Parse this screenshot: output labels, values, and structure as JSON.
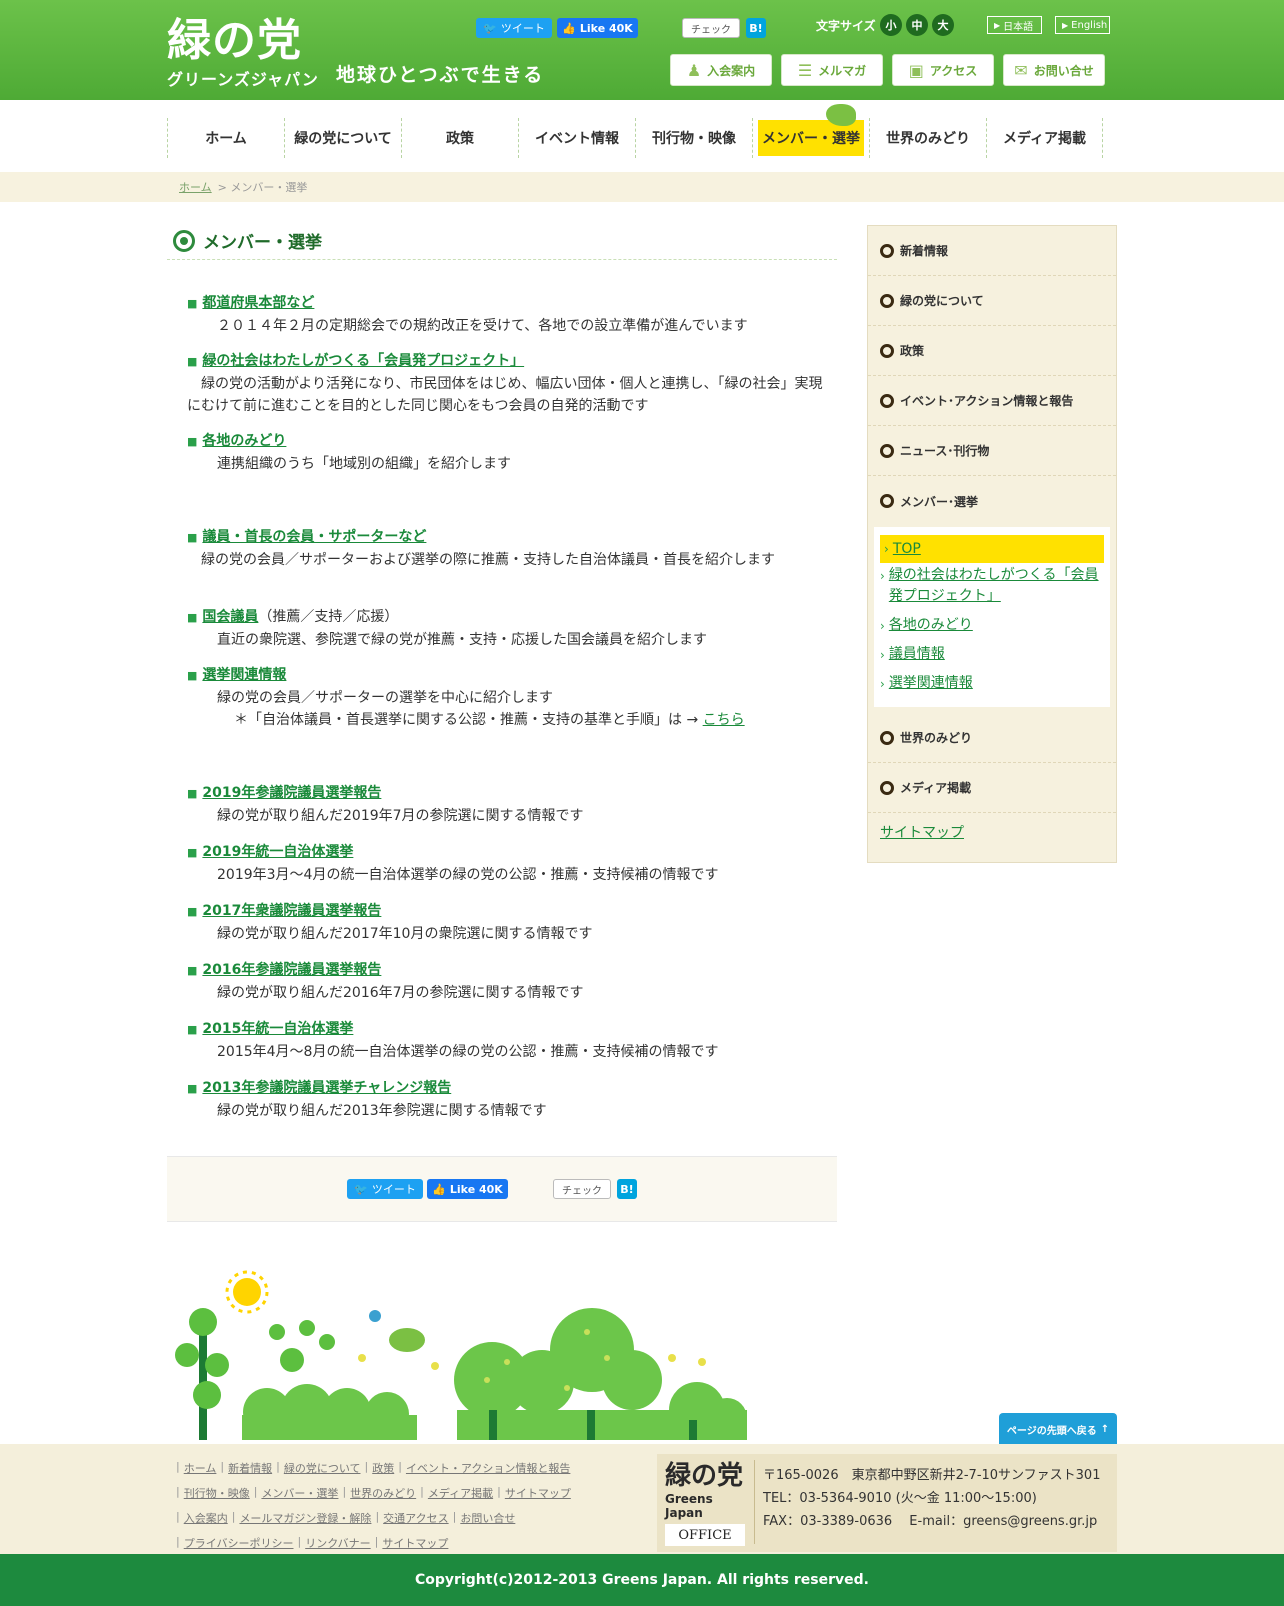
{
  "header": {
    "logo_main": "緑の党",
    "logo_sub": "グリーンズジャパン",
    "tagline": "地球ひとつぶで生きる",
    "share": {
      "tweet": "ツイート",
      "like": "Like 40K",
      "check": "チェック",
      "hatena": "B!"
    },
    "fontsize_label": "文字サイズ",
    "fontsize": [
      "小",
      "中",
      "大"
    ],
    "lang_ja": "日本語",
    "lang_en": "English",
    "buttons": [
      {
        "label": "入会案内",
        "icon": "join-icon"
      },
      {
        "label": "メルマガ",
        "icon": "newsletter-icon"
      },
      {
        "label": "アクセス",
        "icon": "train-icon"
      },
      {
        "label": "お問い合せ",
        "icon": "mail-icon"
      }
    ]
  },
  "nav": [
    "ホーム",
    "緑の党について",
    "政策",
    "イベント情報",
    "刊行物・映像",
    "メンバー・選挙",
    "世界のみどり",
    "メディア掲載"
  ],
  "breadcrumb": {
    "home": "ホーム",
    "current": "> メンバー・選挙"
  },
  "main": {
    "title": "メンバー・選挙",
    "entries": [
      {
        "link": "都道府県本部など",
        "desc": "２０１４年２月の定期総会での規約改正を受けて、各地での設立準備が進んでいます"
      },
      {
        "link": "緑の社会はわたしがつくる「会員発プロジェクト」",
        "desc": "緑の党の活動がより活発になり、市民団体をはじめ、幅広い団体・個人と連携し、「緑の社会」実現にむけて前に進むことを目的とした同じ関心をもつ会員の自発的活動です"
      },
      {
        "link": "各地のみどり",
        "desc": "連携組織のうち「地域別の組織」を紹介します"
      },
      {
        "link": "議員・首長の会員・サポーターなど",
        "desc": "緑の党の会員／サポーターおよび選挙の際に推薦・支持した自治体議員・首長を紹介します"
      },
      {
        "link": "国会議員",
        "note": "（推薦／支持／応援）",
        "desc": "直近の衆院選、参院選で緑の党が推薦・支持・応援した国会議員を紹介します"
      },
      {
        "link": "選挙関連情報",
        "desc": "緑の党の会員／サポーターの選挙を中心に紹介します",
        "sub": "＊「自治体議員・首長選挙に関する公認・推薦・支持の基準と手順」は →",
        "sub_link": "こちら"
      },
      {
        "link": "2019年参議院議員選挙報告",
        "desc": "緑の党が取り組んだ2019年7月の参院選に関する情報です"
      },
      {
        "link": "2019年統一自治体選挙",
        "desc": "2019年3月～4月の統一自治体選挙の緑の党の公認・推薦・支持候補の情報です"
      },
      {
        "link": "2017年衆議院議員選挙報告",
        "desc": "緑の党が取り組んだ2017年10月の衆院選に関する情報です"
      },
      {
        "link": "2016年参議院議員選挙報告",
        "desc": "緑の党が取り組んだ2016年7月の参院選に関する情報です"
      },
      {
        "link": "2015年統一自治体選挙",
        "desc": "2015年4月～8月の統一自治体選挙の緑の党の公認・推薦・支持候補の情報です"
      },
      {
        "link": "2013年参議院議員選挙チャレンジ報告",
        "desc": "緑の党が取り組んだ2013年参院選に関する情報です"
      }
    ]
  },
  "sidebar": {
    "items": [
      "新着情報",
      "緑の党について",
      "政策",
      "イベント･アクション情報と報告",
      "ニュース･刊行物",
      "メンバー･選挙"
    ],
    "subitems": [
      "TOP",
      "緑の社会はわたしがつくる「会員発プロジェクト」",
      "各地のみどり",
      "議員情報",
      "選挙関連情報"
    ],
    "items_after": [
      "世界のみどり",
      "メディア掲載"
    ],
    "sitemap": "サイトマップ"
  },
  "pagetop": "ページの先頭へ戻る",
  "footer": {
    "lines": [
      [
        "ホーム",
        "新着情報",
        "緑の党について",
        "政策",
        "イベント・アクション情報と報告"
      ],
      [
        "刊行物・映像",
        "メンバー・選挙",
        "世界のみどり",
        "メディア掲載",
        "サイトマップ"
      ],
      [
        "入会案内",
        "メールマガジン登録・解除",
        "交通アクセス",
        "お問い合せ"
      ],
      [
        "プライバシーポリシー",
        "リンクバナー",
        "サイトマップ"
      ]
    ],
    "office_logo": "緑の党",
    "office_logo_sub": "Greens Japan",
    "office_label": "OFFICE",
    "address": "〒165-0026　東京都中野区新井2-7-10サンファスト301",
    "tel": "TEL：03-5364-9010 (火～金 11:00～15:00)",
    "fax": "FAX：03-3389-0636　 E-mail：greens@greens.gr.jp"
  },
  "copyright": "Copyright(c)2012-2013 Greens Japan. All rights reserved."
}
